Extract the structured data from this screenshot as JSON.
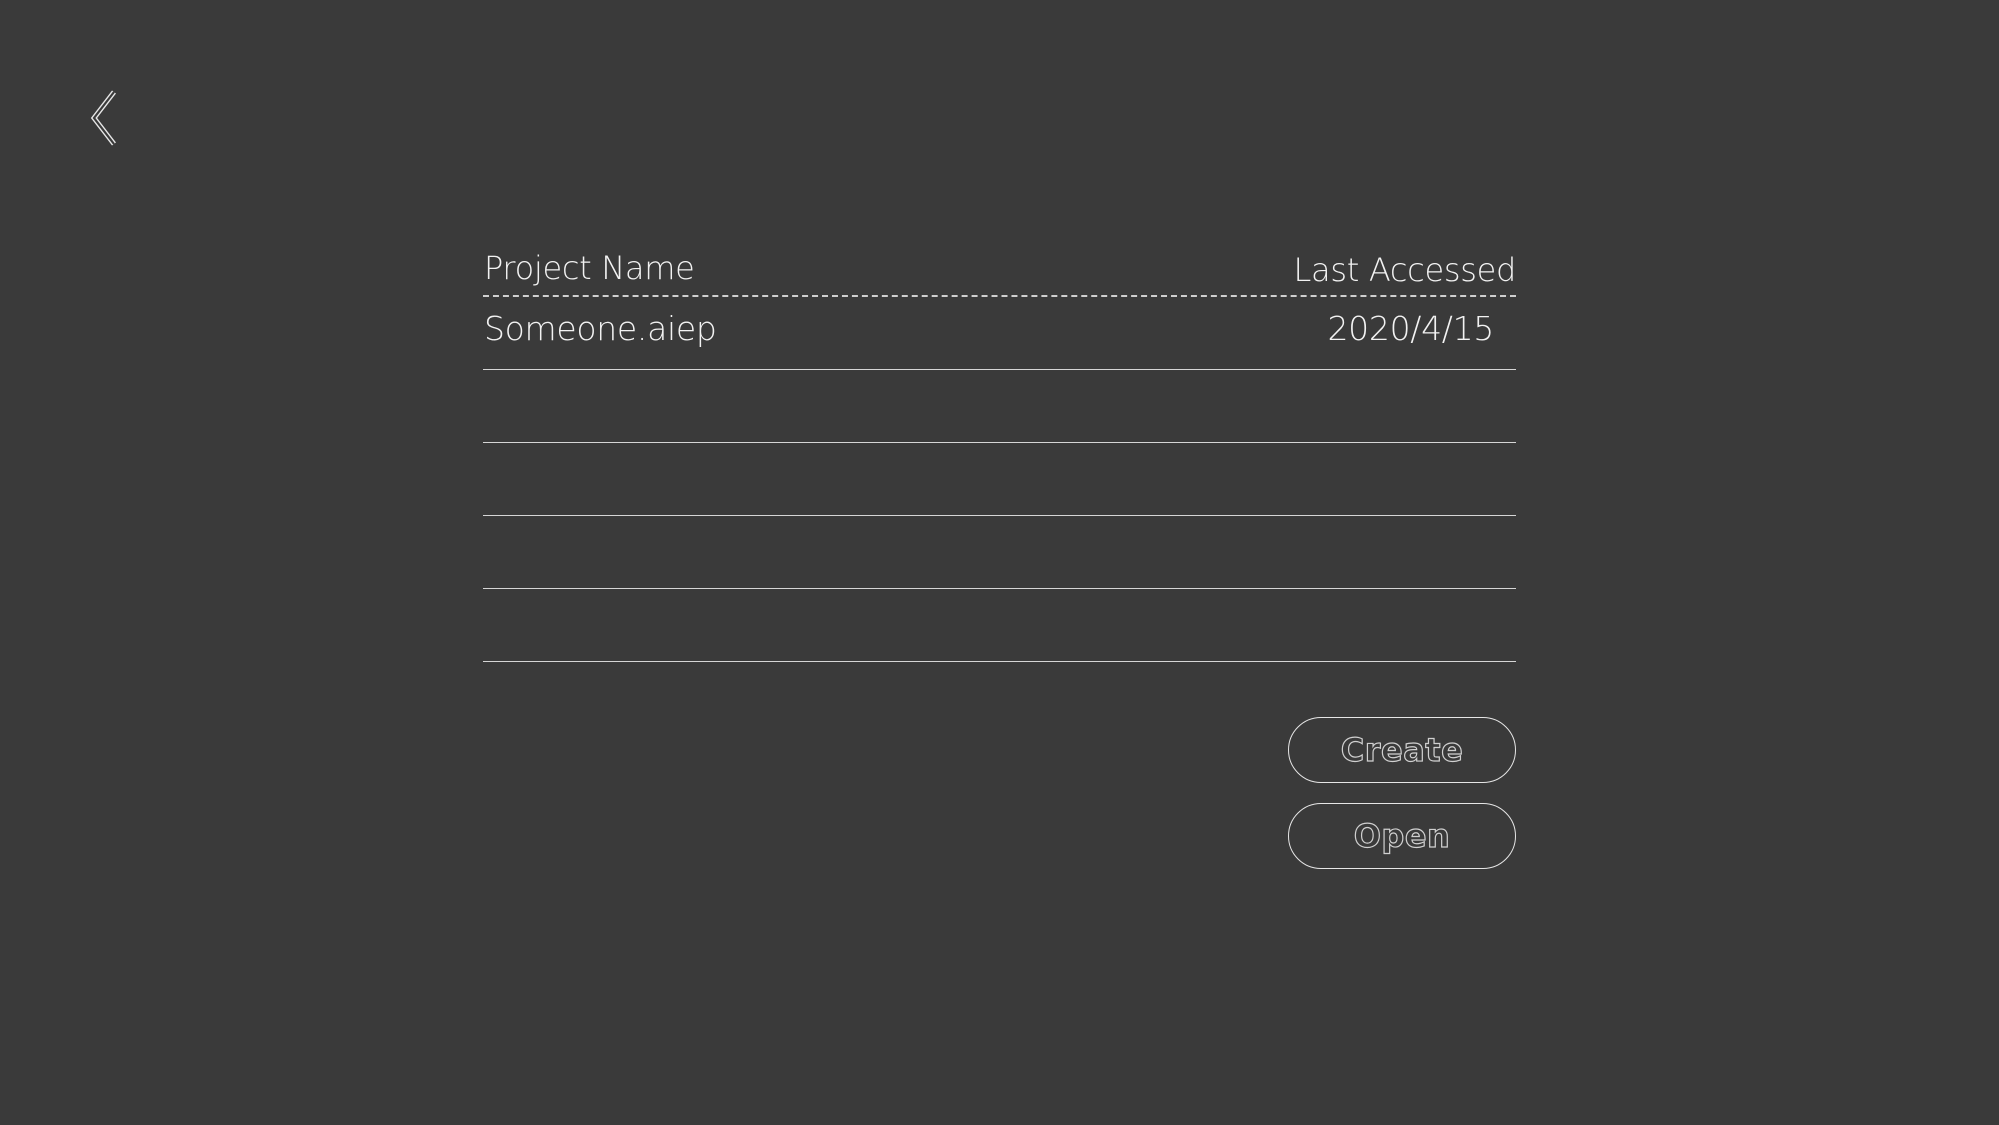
{
  "navigation": {
    "back_icon": "chevron-left-icon"
  },
  "table": {
    "headers": {
      "name": "Project Name",
      "date": "Last Accessed"
    },
    "rows": [
      {
        "name": "Someone.aiep",
        "date": "2020/4/15"
      },
      {
        "name": "",
        "date": ""
      },
      {
        "name": "",
        "date": ""
      },
      {
        "name": "",
        "date": ""
      },
      {
        "name": "",
        "date": ""
      }
    ]
  },
  "actions": {
    "create_label": "Create",
    "open_label": "Open"
  },
  "colors": {
    "background": "#3a3a3a",
    "text": "#f2f2f2",
    "line": "#d6d6d6"
  }
}
